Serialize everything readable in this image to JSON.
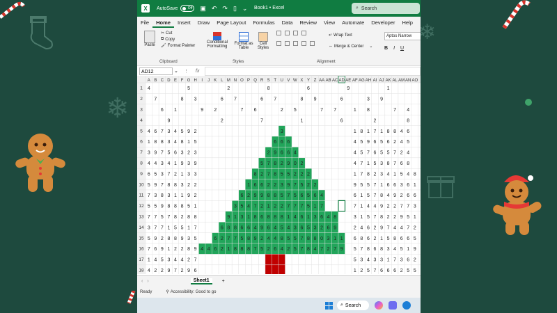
{
  "titlebar": {
    "autosave": "AutoSave",
    "toggle": "Off",
    "doc_title": "Book1 • Excel",
    "search": "Search"
  },
  "tabs": [
    "File",
    "Home",
    "Insert",
    "Draw",
    "Page Layout",
    "Formulas",
    "Data",
    "Review",
    "View",
    "Automate",
    "Developer",
    "Help"
  ],
  "ribbon": {
    "paste": "Paste",
    "cut": "Cut",
    "copy": "Copy",
    "format_painter": "Format Painter",
    "clipboard": "Clipboard",
    "cond_fmt": "Conditional Formatting",
    "format_table": "Format as Table",
    "cell_styles": "Cell Styles",
    "styles": "Styles",
    "wrap_text": "Wrap Text",
    "merge_center": "Merge & Center",
    "alignment": "Alignment",
    "font_name": "Aptos Narrow",
    "bold": "B",
    "italic": "I",
    "underline": "U"
  },
  "namebox": "AD12",
  "fx": "fx",
  "columns": [
    "A",
    "B",
    "C",
    "D",
    "E",
    "F",
    "G",
    "H",
    "I",
    "J",
    "K",
    "L",
    "M",
    "N",
    "O",
    "P",
    "Q",
    "R",
    "S",
    "T",
    "U",
    "V",
    "W",
    "X",
    "Y",
    "Z",
    "AA",
    "AB",
    "AC",
    "AD",
    "AE",
    "AF",
    "AG",
    "AH",
    "AI",
    "AJ",
    "AK",
    "AL",
    "AM",
    "AN",
    "AO"
  ],
  "rows": [
    [
      "4",
      "",
      "",
      "",
      "",
      "",
      "5",
      "",
      "",
      "",
      "",
      "",
      "2",
      "",
      "",
      "",
      "",
      "",
      "8",
      "",
      "",
      "",
      "",
      "",
      "6",
      "",
      "",
      "",
      "",
      "",
      "9",
      "",
      "",
      "",
      "",
      "",
      "1",
      "",
      "",
      "",
      ""
    ],
    [
      "",
      "7",
      "",
      "",
      "",
      "8",
      "",
      "3",
      "",
      "",
      "",
      "6",
      "",
      "7",
      "",
      "",
      "",
      "6",
      "",
      "7",
      "",
      "",
      "",
      "8",
      "",
      "9",
      "",
      "",
      "",
      "6",
      "",
      "",
      "",
      "3",
      "",
      "9",
      "",
      "",
      "",
      "",
      ""
    ],
    [
      "",
      "",
      "6",
      "",
      "1",
      "",
      "",
      "",
      "9",
      "",
      "2",
      "",
      "",
      "",
      "7",
      "",
      "6",
      "",
      "",
      "",
      "2",
      "",
      "5",
      "",
      "",
      "",
      "7",
      "",
      "7",
      "",
      "",
      "1",
      "",
      "8",
      "",
      "",
      "",
      "7",
      "",
      "4",
      ""
    ],
    [
      "",
      "",
      "",
      "9",
      "",
      "",
      "",
      "",
      "",
      "",
      "",
      "2",
      "",
      "",
      "",
      "",
      "",
      "7",
      "",
      "",
      "",
      "",
      "",
      "1",
      "",
      "",
      "",
      "",
      "",
      "6",
      "",
      "",
      "",
      "",
      "2",
      "",
      "",
      "",
      "",
      "8",
      ""
    ],
    [
      "4",
      "6",
      "7",
      "3",
      "4",
      "5",
      "9",
      "2",
      "",
      "",
      "",
      "",
      "",
      "",
      "",
      "",
      "",
      "",
      "",
      "",
      "3",
      "",
      "",
      "",
      "",
      "",
      "",
      "",
      "",
      "",
      "",
      "1",
      "8",
      "1",
      "7",
      "1",
      "8",
      "8",
      "4",
      "6",
      ""
    ],
    [
      "1",
      "8",
      "8",
      "3",
      "4",
      "8",
      "1",
      "5",
      "",
      "",
      "",
      "",
      "",
      "",
      "",
      "",
      "",
      "",
      "",
      "6",
      "6",
      "6",
      "",
      "",
      "",
      "",
      "",
      "",
      "",
      "",
      "",
      "4",
      "5",
      "9",
      "6",
      "5",
      "6",
      "2",
      "4",
      "5",
      ""
    ],
    [
      "3",
      "9",
      "7",
      "5",
      "6",
      "3",
      "2",
      "3",
      "",
      "",
      "",
      "",
      "",
      "",
      "",
      "",
      "",
      "",
      "2",
      "9",
      "6",
      "6",
      "4",
      "",
      "",
      "",
      "",
      "",
      "",
      "",
      "",
      "4",
      "5",
      "7",
      "6",
      "5",
      "5",
      "7",
      "2",
      "4",
      ""
    ],
    [
      "4",
      "4",
      "3",
      "4",
      "1",
      "9",
      "3",
      "9",
      "",
      "",
      "",
      "",
      "",
      "",
      "",
      "",
      "",
      "5",
      "7",
      "8",
      "2",
      "9",
      "0",
      "2",
      "",
      "",
      "",
      "",
      "",
      "",
      "",
      "4",
      "7",
      "1",
      "5",
      "3",
      "8",
      "7",
      "6",
      "8",
      ""
    ],
    [
      "6",
      "5",
      "3",
      "7",
      "2",
      "1",
      "3",
      "3",
      "",
      "",
      "",
      "",
      "",
      "",
      "",
      "",
      "8",
      "2",
      "7",
      "8",
      "5",
      "5",
      "2",
      "2",
      "2",
      "",
      "",
      "",
      "",
      "",
      "",
      "1",
      "7",
      "8",
      "2",
      "3",
      "4",
      "1",
      "5",
      "4",
      "8"
    ],
    [
      "5",
      "9",
      "7",
      "8",
      "8",
      "3",
      "2",
      "2",
      "",
      "",
      "",
      "",
      "",
      "",
      "",
      "1",
      "6",
      "6",
      "2",
      "2",
      "3",
      "9",
      "7",
      "5",
      "2",
      "2",
      "",
      "",
      "",
      "",
      "",
      "9",
      "5",
      "5",
      "7",
      "1",
      "6",
      "6",
      "3",
      "6",
      "1"
    ],
    [
      "7",
      "3",
      "8",
      "3",
      "1",
      "1",
      "9",
      "2",
      "",
      "",
      "",
      "",
      "",
      "",
      "6",
      "2",
      "9",
      "9",
      "8",
      "8",
      "5",
      "7",
      "5",
      "6",
      "5",
      "6",
      "4",
      "",
      "",
      "",
      "",
      "6",
      "1",
      "5",
      "7",
      "8",
      "4",
      "9",
      "2",
      "6",
      "6"
    ],
    [
      "5",
      "5",
      "9",
      "8",
      "8",
      "8",
      "5",
      "1",
      "",
      "",
      "",
      "",
      "",
      "3",
      "5",
      "4",
      "7",
      "2",
      "1",
      "2",
      "2",
      "7",
      "7",
      "7",
      "5",
      "1",
      "7",
      "",
      "",
      "",
      "",
      "7",
      "1",
      "4",
      "4",
      "9",
      "2",
      "2",
      "7",
      "7",
      "3"
    ],
    [
      "7",
      "7",
      "5",
      "7",
      "8",
      "2",
      "8",
      "8",
      "",
      "",
      "",
      "",
      "9",
      "1",
      "3",
      "1",
      "8",
      "6",
      "8",
      "8",
      "8",
      "1",
      "4",
      "6",
      "1",
      "3",
      "6",
      "4",
      "8",
      "",
      "",
      "3",
      "1",
      "5",
      "7",
      "8",
      "2",
      "2",
      "9",
      "5",
      "1"
    ],
    [
      "3",
      "7",
      "7",
      "1",
      "5",
      "5",
      "1",
      "7",
      "",
      "",
      "",
      "6",
      "8",
      "8",
      "6",
      "6",
      "4",
      "9",
      "6",
      "4",
      "5",
      "4",
      "3",
      "6",
      "5",
      "3",
      "2",
      "6",
      "9",
      "",
      "",
      "2",
      "4",
      "6",
      "2",
      "9",
      "7",
      "4",
      "4",
      "7",
      "2"
    ],
    [
      "5",
      "9",
      "2",
      "8",
      "8",
      "9",
      "3",
      "5",
      "",
      "",
      "6",
      "2",
      "7",
      "7",
      "5",
      "8",
      "9",
      "2",
      "4",
      "4",
      "8",
      "5",
      "5",
      "7",
      "8",
      "8",
      "0",
      "3",
      "1",
      "1",
      "",
      "6",
      "8",
      "6",
      "2",
      "1",
      "5",
      "8",
      "6",
      "6",
      "5"
    ],
    [
      "7",
      "6",
      "9",
      "1",
      "2",
      "2",
      "8",
      "9",
      "4",
      "4",
      "6",
      "2",
      "1",
      "8",
      "8",
      "8",
      "7",
      "5",
      "2",
      "6",
      "4",
      "2",
      "5",
      "7",
      "8",
      "4",
      "7",
      "2",
      "7",
      "9",
      "",
      "5",
      "7",
      "8",
      "6",
      "8",
      "3",
      "4",
      "5",
      "1",
      "9"
    ],
    [
      "1",
      "4",
      "5",
      "3",
      "4",
      "4",
      "2",
      "7",
      "",
      "",
      "",
      "",
      "",
      "",
      "",
      "",
      "",
      "",
      "",
      "",
      "",
      "",
      "",
      "",
      "",
      "",
      "",
      "",
      "",
      "",
      "",
      "5",
      "3",
      "4",
      "3",
      "3",
      "1",
      "7",
      "3",
      "6",
      "2"
    ],
    [
      "4",
      "2",
      "2",
      "9",
      "7",
      "2",
      "9",
      "6",
      "",
      "",
      "",
      "",
      "",
      "",
      "",
      "",
      "",
      "",
      "",
      "",
      "",
      "",
      "",
      "",
      "",
      "",
      "",
      "",
      "",
      "",
      "",
      "1",
      "2",
      "5",
      "7",
      "6",
      "6",
      "6",
      "2",
      "5",
      "5"
    ],
    [
      "6",
      "7",
      "7",
      "9",
      "2",
      "8",
      "2",
      "7",
      "",
      "",
      "",
      "",
      "",
      "",
      "",
      "",
      "",
      "",
      "",
      "",
      "",
      "",
      "",
      "",
      "",
      "",
      "",
      "",
      "",
      "",
      "",
      "1",
      "6",
      "9",
      "1",
      "4",
      "4",
      "6",
      "9",
      "6",
      "5"
    ]
  ],
  "sheet_tab": "Sheet1",
  "status": {
    "ready": "Ready",
    "accessibility": "Accessibility: Good to go"
  },
  "taskbar": {
    "search": "Search"
  },
  "colors": {
    "tree": "#21a55a",
    "trunk": "#c00000",
    "excel_green": "#107c41",
    "background": "#1e4a3e"
  }
}
